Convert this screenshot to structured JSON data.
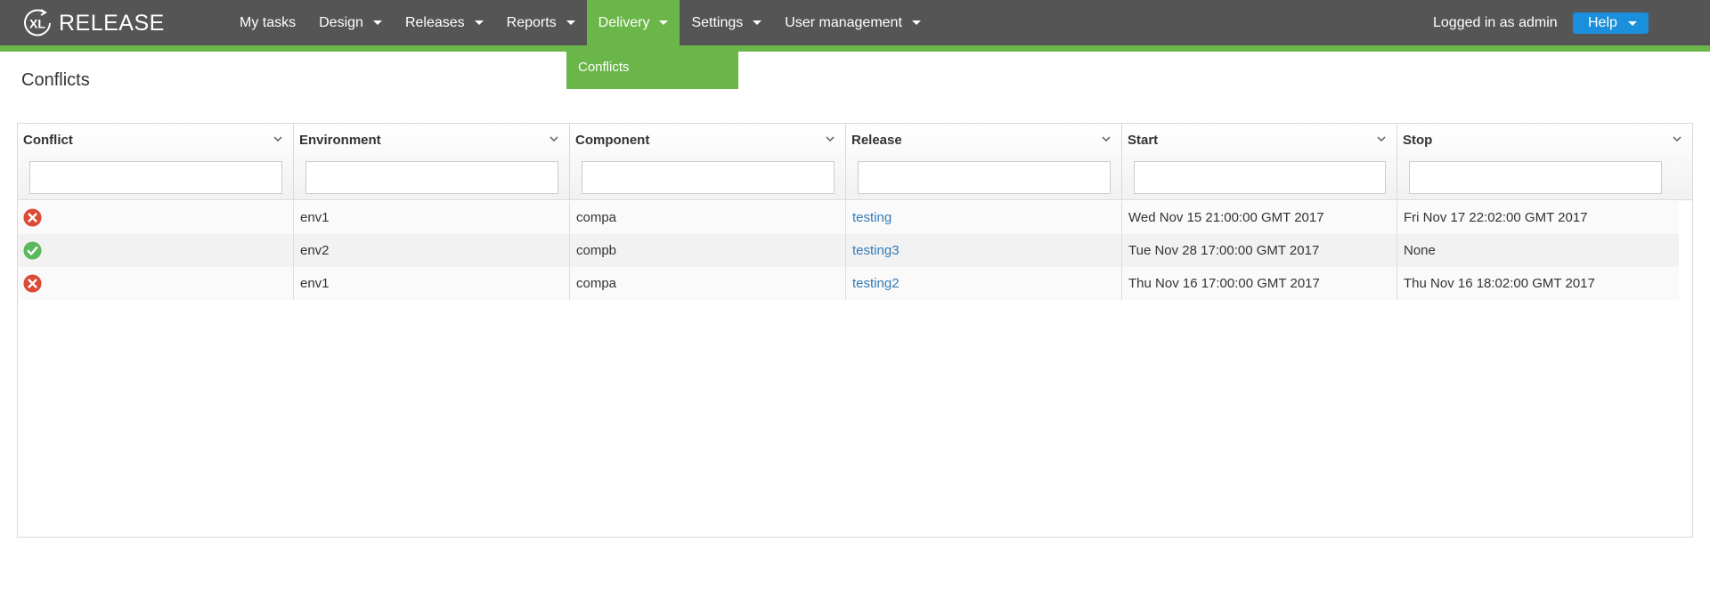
{
  "app": {
    "title": "RELEASE",
    "logo_text": "XL"
  },
  "nav": {
    "items": [
      {
        "label": "My tasks",
        "has_caret": false,
        "active": false
      },
      {
        "label": "Design",
        "has_caret": true,
        "active": false
      },
      {
        "label": "Releases",
        "has_caret": true,
        "active": false
      },
      {
        "label": "Reports",
        "has_caret": true,
        "active": false
      },
      {
        "label": "Delivery",
        "has_caret": true,
        "active": true
      },
      {
        "label": "Settings",
        "has_caret": true,
        "active": false
      },
      {
        "label": "User management",
        "has_caret": true,
        "active": false
      }
    ],
    "user_label": "Logged in as admin",
    "help_label": "Help"
  },
  "dropdown": {
    "items": [
      {
        "label": "Conflicts"
      }
    ]
  },
  "page": {
    "title": "Conflicts"
  },
  "table": {
    "columns": [
      {
        "key": "conflict",
        "label": "Conflict"
      },
      {
        "key": "environment",
        "label": "Environment"
      },
      {
        "key": "component",
        "label": "Component"
      },
      {
        "key": "release",
        "label": "Release"
      },
      {
        "key": "start",
        "label": "Start"
      },
      {
        "key": "stop",
        "label": "Stop"
      }
    ],
    "filters": [
      "",
      "",
      "",
      "",
      "",
      ""
    ],
    "rows": [
      {
        "conflict": "error",
        "environment": "env1",
        "component": "compa",
        "release": "testing",
        "start": "Wed Nov 15 21:00:00 GMT 2017",
        "stop": "Fri Nov 17 22:02:00 GMT 2017"
      },
      {
        "conflict": "ok",
        "environment": "env2",
        "component": "compb",
        "release": "testing3",
        "start": "Tue Nov 28 17:00:00 GMT 2017",
        "stop": "None"
      },
      {
        "conflict": "error",
        "environment": "env1",
        "component": "compa",
        "release": "testing2",
        "start": "Thu Nov 16 17:00:00 GMT 2017",
        "stop": "Thu Nov 16 18:02:00 GMT 2017"
      }
    ]
  },
  "icons": {
    "error": "close-circle-icon",
    "ok": "check-circle-icon",
    "column_menu": "chevron-down-icon"
  },
  "colors": {
    "topbar": "#555555",
    "accent_green": "#6ab648",
    "help_blue": "#1a8fdb",
    "error_red": "#dc4a38",
    "ok_green": "#5cb85c",
    "link_blue": "#337ab7"
  }
}
